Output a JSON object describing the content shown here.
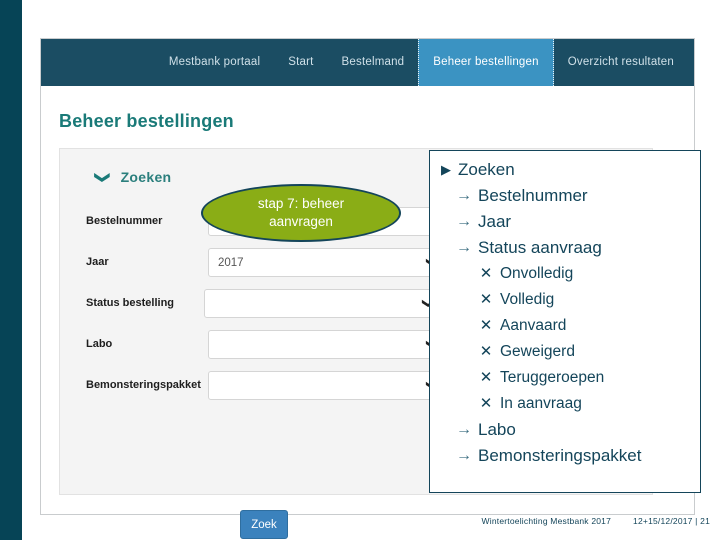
{
  "navbar": {
    "items": [
      {
        "label": "Mestbank portaal",
        "active": false
      },
      {
        "label": "Start",
        "active": false
      },
      {
        "label": "Bestelmand",
        "active": false
      },
      {
        "label": "Beheer bestellingen",
        "active": true
      },
      {
        "label": "Overzicht resultaten",
        "active": false
      }
    ]
  },
  "page": {
    "title": "Beheer bestellingen"
  },
  "callout": {
    "line1": "stap 7: beheer",
    "line2": "aanvragen",
    "fill_color": "#8aad16",
    "border_color": "#14455a"
  },
  "search_panel": {
    "header_label": "Zoeken",
    "header_icon": "chevron-down-icon",
    "fields": [
      {
        "label": "Bestelnummer",
        "type": "text",
        "value": "",
        "placeholder": ""
      },
      {
        "label": "Jaar",
        "type": "select",
        "value": "2017"
      },
      {
        "label": "Status bestelling",
        "type": "select",
        "value": ""
      },
      {
        "label": "Labo",
        "type": "select",
        "value": ""
      },
      {
        "label": "Bemonsteringspakket",
        "type": "select",
        "value": ""
      }
    ],
    "submit_label": "Zoek",
    "submit_color": "#3b82bd"
  },
  "notes_panel": {
    "items": [
      {
        "level": 1,
        "marker": "▶",
        "text": "Zoeken"
      },
      {
        "level": 2,
        "marker": "→",
        "text": "Bestelnummer"
      },
      {
        "level": 2,
        "marker": "→",
        "text": "Jaar"
      },
      {
        "level": 2,
        "marker": "→",
        "text": "Status aanvraag"
      },
      {
        "level": 3,
        "marker": "✕",
        "text": "Onvolledig"
      },
      {
        "level": 3,
        "marker": "✕",
        "text": "Volledig"
      },
      {
        "level": 3,
        "marker": "✕",
        "text": "Aanvaard"
      },
      {
        "level": 3,
        "marker": "✕",
        "text": "Geweigerd"
      },
      {
        "level": 3,
        "marker": "✕",
        "text": "Teruggeroepen"
      },
      {
        "level": 3,
        "marker": "✕",
        "text": "In aanvraag"
      },
      {
        "level": 2,
        "marker": "→",
        "text": "Labo"
      },
      {
        "level": 2,
        "marker": "→",
        "text": "Bemonsteringspakket"
      }
    ]
  },
  "footer": {
    "left_text": "Wintertoelichting Mestbank 2017",
    "right_text": "12+15/12/2017 | 21"
  },
  "theme": {
    "navbar_bg": "#1b4d63",
    "nav_active_bg": "#3b93c2",
    "title_color": "#1a7a78",
    "left_strip": "#064456"
  }
}
